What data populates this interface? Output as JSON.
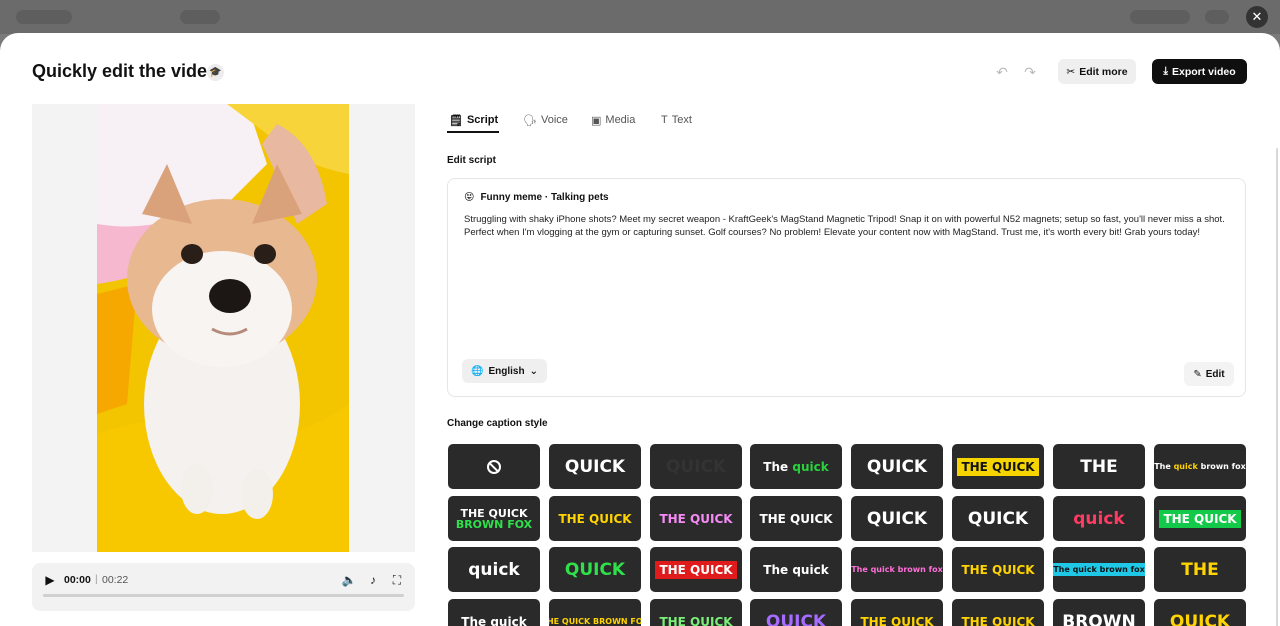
{
  "modal": {
    "title": "Quickly edit the video",
    "edit_more_label": "Edit more",
    "export_label": "Export video"
  },
  "player": {
    "current_time": "00:00",
    "separator": "|",
    "total_time": "00:22",
    "progress": 0
  },
  "tabs": [
    {
      "label": "Script",
      "icon": "script-icon",
      "active": true
    },
    {
      "label": "Voice",
      "icon": "voice-icon",
      "active": false
    },
    {
      "label": "Media",
      "icon": "media-icon",
      "active": false
    },
    {
      "label": "Text",
      "icon": "text-icon",
      "active": false
    }
  ],
  "script": {
    "section_label": "Edit script",
    "emoji": "😝",
    "header": "Funny meme · Talking pets",
    "body": "Struggling with shaky iPhone shots? Meet my secret weapon - KraftGeek's MagStand Magnetic Tripod! Snap it on with powerful N52 magnets; setup so fast, you'll never miss a shot. Perfect when I'm vlogging at the gym or capturing sunset. Golf courses? No problem! Elevate your content now with MagStand. Trust me, it's worth every bit! Grab yours today!",
    "language": "English",
    "edit_label": "Edit"
  },
  "captions": {
    "section_label": "Change caption style",
    "styles": [
      {
        "text": "",
        "color": "#ffffff"
      },
      {
        "text": "QUICK",
        "color": "#ffffff"
      },
      {
        "text": "QUICK",
        "color": "#333333"
      },
      {
        "text": "The quick",
        "color": "#ffffff",
        "accent": "#29d13d"
      },
      {
        "text": "QUICK",
        "color": "#ffffff"
      },
      {
        "text": "THE QUICK",
        "color": "#111111",
        "bg": "#f5d400"
      },
      {
        "text": "THE",
        "color": "#ffffff"
      },
      {
        "text": "The quick brown fox",
        "color": "#ffffff",
        "accent": "#ffd400"
      },
      {
        "text": "THE QUICK BROWN FOX",
        "color": "#ffffff",
        "accent": "#2fe04a"
      },
      {
        "text": "THE QUICK",
        "color": "#ffd400"
      },
      {
        "text": "THE QUICK",
        "color": "#f58cf5"
      },
      {
        "text": "THE QUICK",
        "color": "#ffffff"
      },
      {
        "text": "QUICK",
        "color": "#ffffff"
      },
      {
        "text": "QUICK",
        "color": "#ffffff"
      },
      {
        "text": "quick",
        "color": "#ff3b63"
      },
      {
        "text": "THE QUICK",
        "color": "#ffffff",
        "bg": "#13c94a"
      },
      {
        "text": "quick",
        "color": "#ffffff"
      },
      {
        "text": "QUICK",
        "color": "#2fe04a"
      },
      {
        "text": "THE QUICK",
        "color": "#ffffff",
        "bg": "#e01b1b"
      },
      {
        "text": "The quick",
        "color": "#ffffff"
      },
      {
        "text": "The quick brown fox",
        "color": "#ff6fd8"
      },
      {
        "text": "THE QUICK",
        "color": "#ffd400"
      },
      {
        "text": "The quick brown fox",
        "color": "#111111",
        "bg": "#1ec8e6"
      },
      {
        "text": "THE",
        "color": "#ffd400"
      },
      {
        "text": "The quick",
        "color": "#ffffff"
      },
      {
        "text": "THE QUICK BROWN FOX",
        "color": "#ffd400"
      },
      {
        "text": "THE QUICK",
        "color": "#7af07a"
      },
      {
        "text": "QUICK",
        "color": "#a66bff"
      },
      {
        "text": "THE QUICK",
        "color": "#ffd400"
      },
      {
        "text": "THE QUICK",
        "color": "#ffd400"
      },
      {
        "text": "BROWN",
        "color": "#ffffff"
      },
      {
        "text": "QUICK",
        "color": "#ffd400"
      }
    ]
  },
  "colors": {
    "accent_dark": "#0f0f0f",
    "video_background": "#f2c500"
  }
}
